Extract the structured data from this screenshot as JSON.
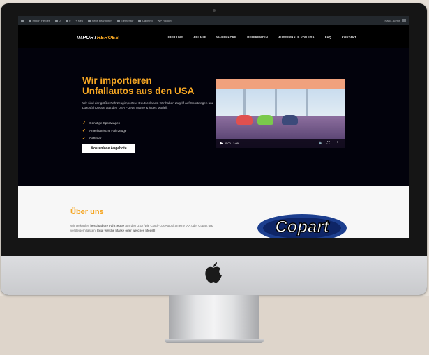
{
  "admin_bar": {
    "items": [
      "Import Heroes",
      "0",
      "0",
      "+ Neu",
      "Seite bearbeiten",
      "Elementor",
      "Caching",
      "WP Rocket"
    ],
    "greeting": "Hallo, Admin"
  },
  "site": {
    "logo_part1": "IMPORT",
    "logo_part2": "HEROES",
    "menu": [
      "ÜBER UNS",
      "ABLAUF",
      "WARENKORB",
      "REFERENZEN",
      "AUSSERHALB VON USA",
      "FAQ",
      "KONTAKT"
    ]
  },
  "hero": {
    "title_line1": "Wir importieren",
    "title_line2": "Unfallautos aus den USA",
    "text": "Wir sind der größte Fahrzeugimporteur Deutschlands. Wir haben Zugriff auf Sportwagen und Luxusfahrzeuge aus den USA – Jede Marke & jedes Modell.",
    "features": [
      "Günstige Sportwagen",
      "Amerikanische Fahrzeuge",
      "Oldtimer"
    ],
    "cta_label": "Kostenlose Angebote",
    "video_time": "0:00 / 1:09",
    "video_controls": {
      "play": "▶",
      "volume": "🔈",
      "fullscreen": "⛶",
      "more": "⋮"
    }
  },
  "about": {
    "title": "Über uns",
    "text_prefix": "Wir verkaufen ",
    "text_bold1": "beschädigte Fahrzeuge",
    "text_mid": " aus den USA (wie Crash-Los Autos) an eine IAA oder Copart und versteigern lassen. ",
    "text_bold2": "Egal welche Marke oder welches Modell",
    "logo_text": "Copart"
  },
  "colors": {
    "accent": "#f5a623",
    "hero_bg": "#02020c",
    "admin_bar": "#23282d",
    "about_bg": "#f7f7f7"
  }
}
